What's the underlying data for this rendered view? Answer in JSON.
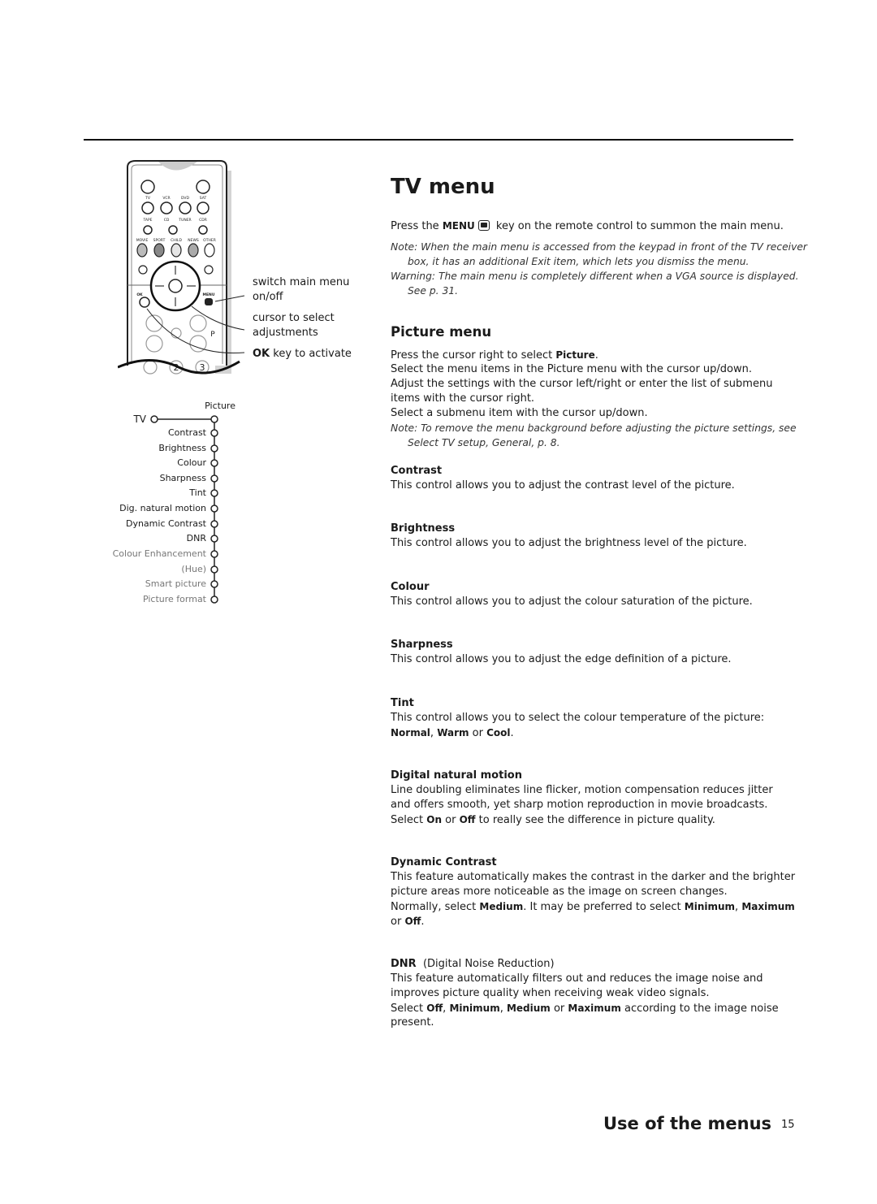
{
  "header": {
    "title": "TV menu"
  },
  "remote": {
    "button_labels": [
      "TV",
      "VCR",
      "DVD",
      "SAT",
      "TAPE",
      "CD",
      "TUNER",
      "CDR",
      "MOVIE",
      "SPORT",
      "CHILD",
      "NEWS",
      "OTHER",
      "OK",
      "MENU",
      "P",
      "2",
      "3"
    ],
    "callouts": [
      {
        "lines": [
          "switch main menu",
          "on/off"
        ]
      },
      {
        "lines": [
          "cursor to select",
          "adjustments"
        ]
      },
      {
        "lines": [
          "key to activate"
        ],
        "bold": "OK"
      }
    ]
  },
  "menu_tree": {
    "root": "TV",
    "submenu": "Picture",
    "items": [
      {
        "label": "Contrast",
        "available": true
      },
      {
        "label": "Brightness",
        "available": true
      },
      {
        "label": "Colour",
        "available": true
      },
      {
        "label": "Sharpness",
        "available": true
      },
      {
        "label": "Tint",
        "available": true
      },
      {
        "label": "Dig. natural motion",
        "available": true
      },
      {
        "label": "Dynamic Contrast",
        "available": true
      },
      {
        "label": "DNR",
        "available": true
      },
      {
        "label": "Colour Enhancement",
        "available": false
      },
      {
        "label": "(Hue)",
        "available": false
      },
      {
        "label": "Smart picture",
        "available": false
      },
      {
        "label": "Picture format",
        "available": false
      }
    ]
  },
  "main": {
    "intro": [
      [
        "Press the ",
        {
          "b": "MENU"
        },
        {
          "icon": "menu-key-icon"
        },
        " key on the remote control to summon the main menu."
      ]
    ],
    "note1": [
      [
        "Note: When the main menu is accessed from the keypad in front of the TV receiver"
      ],
      [
        "box, it has an additional Exit item, which lets you dismiss the menu."
      ],
      [
        "Warning: The main menu is completely different when a VGA source is displayed."
      ],
      [
        "See p. 31."
      ]
    ],
    "section_title": "Picture menu",
    "picture_intro": [
      [
        "Press the cursor right to select ",
        {
          "b": "Picture"
        },
        "."
      ],
      [
        "Select the menu items in the Picture menu with the cursor up/down."
      ],
      [
        "Adjust the settings with the cursor left/right or enter the list of submenu"
      ],
      [
        "items with the cursor right."
      ],
      [
        "Select a submenu item with the cursor up/down."
      ]
    ],
    "note2": [
      [
        "Note: To remove the menu background before adjusting the picture settings, see"
      ],
      [
        "Select TV setup, General, p. 8."
      ]
    ],
    "items": [
      {
        "heading": "Contrast",
        "lines": [
          [
            "This control allows you to adjust the contrast level of the picture."
          ]
        ]
      },
      {
        "heading": "Brightness",
        "lines": [
          [
            "This control allows you to adjust the brightness level of the picture."
          ]
        ]
      },
      {
        "heading": "Colour",
        "lines": [
          [
            "This control allows you to adjust the colour saturation of the picture."
          ]
        ]
      },
      {
        "heading": "Sharpness",
        "lines": [
          [
            "This control allows you to adjust the edge definition of a picture."
          ]
        ]
      },
      {
        "heading": "Tint",
        "lines": [
          [
            "This control allows you to select the colour temperature of the picture:"
          ],
          [
            {
              "b": "Normal"
            },
            ", ",
            {
              "b": "Warm"
            },
            " or ",
            {
              "b": "Cool"
            },
            "."
          ]
        ]
      },
      {
        "heading": "Digital natural motion",
        "lines": [
          [
            "Line doubling eliminates line flicker, motion compensation reduces jitter"
          ],
          [
            "and offers smooth, yet sharp motion reproduction in movie broadcasts."
          ],
          [
            "Select ",
            {
              "b": "On"
            },
            " or ",
            {
              "b": "Off"
            },
            " to really see the difference in picture quality."
          ]
        ]
      },
      {
        "heading": "Dynamic Contrast",
        "lines": [
          [
            "This feature automatically makes the contrast in the darker and the brighter"
          ],
          [
            "picture areas more noticeable as the image on screen changes."
          ],
          [
            "Normally, select ",
            {
              "b": "Medium"
            },
            ". It may be preferred to select ",
            {
              "b": "Minimum"
            },
            ", ",
            {
              "b": "Maximum"
            }
          ],
          [
            "or ",
            {
              "b": "Off"
            },
            "."
          ]
        ]
      },
      {
        "heading": "DNR",
        "heading_suffix": "  (Digital Noise Reduction)",
        "lines": [
          [
            "This feature automatically filters out and reduces the image noise and"
          ],
          [
            "improves picture quality when receiving weak video signals."
          ],
          [
            "Select ",
            {
              "b": "Off"
            },
            ", ",
            {
              "b": "Minimum"
            },
            ", ",
            {
              "b": "Medium"
            },
            " or ",
            {
              "b": "Maximum"
            },
            " according to the image noise"
          ],
          [
            "present."
          ]
        ]
      }
    ]
  },
  "footer": {
    "section": "Use of the menus",
    "page_number": "15"
  }
}
